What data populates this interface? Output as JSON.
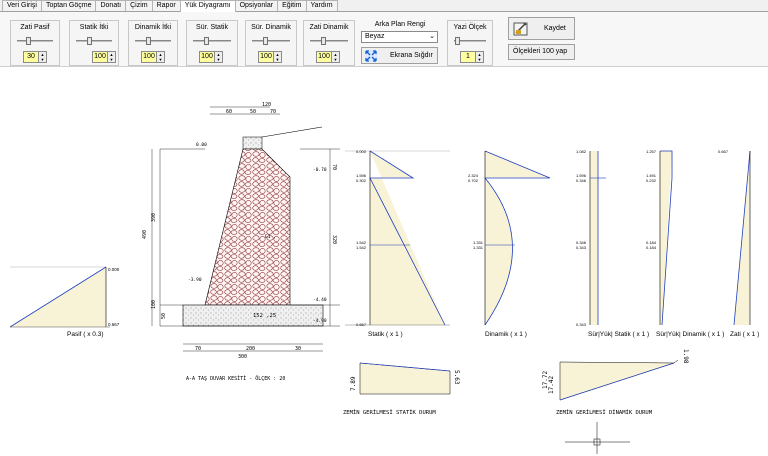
{
  "tabs": [
    "Veri Girişi",
    "Toptan Göçme",
    "Donatı",
    "Çizim",
    "Rapor",
    "Yük Diyagramı",
    "Opsiyonlar",
    "Eğitim",
    "Yardım"
  ],
  "active_tab": "Yük Diyagramı",
  "sliders": [
    {
      "label": "Zati Pasif",
      "value": "30",
      "level": 0.25
    },
    {
      "label": "Statik İtki",
      "value": "100",
      "level": 0.3
    },
    {
      "label": "Dinamik İtki",
      "value": "100",
      "level": 0.3
    },
    {
      "label": "Sür. Statik",
      "value": "100",
      "level": 0.3
    },
    {
      "label": "Sür. Dinamik",
      "value": "100",
      "level": 0.3
    },
    {
      "label": "Zati Dinamik",
      "value": "100",
      "level": 0.3
    }
  ],
  "background": {
    "label": "Arka Plan Rengi",
    "selected": "Beyaz",
    "fit_label": "Ekrana Sığdır"
  },
  "text_scale": {
    "label": "Yazi Ölçek",
    "value": "1",
    "level": 0.05
  },
  "save_label": "Kaydet",
  "scale_100_label": "Ölçekleri 100 yap",
  "wall": {
    "title": "A-A TAŞ DUVAR KESİTİ - ÖLÇEK : 20",
    "top_dims": [
      "120",
      "60",
      "50",
      "70"
    ],
    "left_dims": [
      "490",
      "390",
      "100",
      "50"
    ],
    "right_dims": [
      "70",
      "320"
    ],
    "bottom_dims": [
      "70",
      "200",
      "30",
      "300"
    ],
    "levels": [
      "0.00",
      "-0.70",
      "-3.90",
      "-4.40",
      "-4.90"
    ],
    "labels": [
      "152 ,25",
      "E1 ,"
    ]
  },
  "passive_diagram": {
    "caption": "Pasif ( x 0.3)",
    "values": [
      "0.000",
      "0.667"
    ]
  },
  "diagrams": [
    {
      "caption": "Statik ( x 1 )",
      "values": [
        "0.000",
        "1.596",
        "0.302",
        "1.542",
        "1.542",
        "0.667"
      ]
    },
    {
      "caption": "Dinamik ( x 1 )",
      "values": [
        "2.324",
        "0.702",
        "1.331",
        "1.331"
      ]
    },
    {
      "caption": "Sür|Yük| Statik ( x 1 )",
      "values": [
        "1.082",
        "1.596",
        "0.346",
        "0.346",
        "0.343",
        "0.343"
      ]
    },
    {
      "caption": "Sür|Yük| Dinamik ( x 1 )",
      "values": [
        "1.257",
        "1.491",
        "0.232",
        "0.184",
        "0.184"
      ]
    },
    {
      "caption": "Zati ( x 1 )",
      "values": [
        "0.667"
      ]
    }
  ],
  "soil_static": {
    "title": "ZEMİN GERİLMESİ STATİK DURUM",
    "left": "7.89",
    "right": "5.63"
  },
  "soil_dynamic": {
    "title": "ZEMİN GERİLMESİ DİNAMİK DURUM",
    "left": "17.42",
    "left2": "17.72",
    "right": "1.98"
  }
}
